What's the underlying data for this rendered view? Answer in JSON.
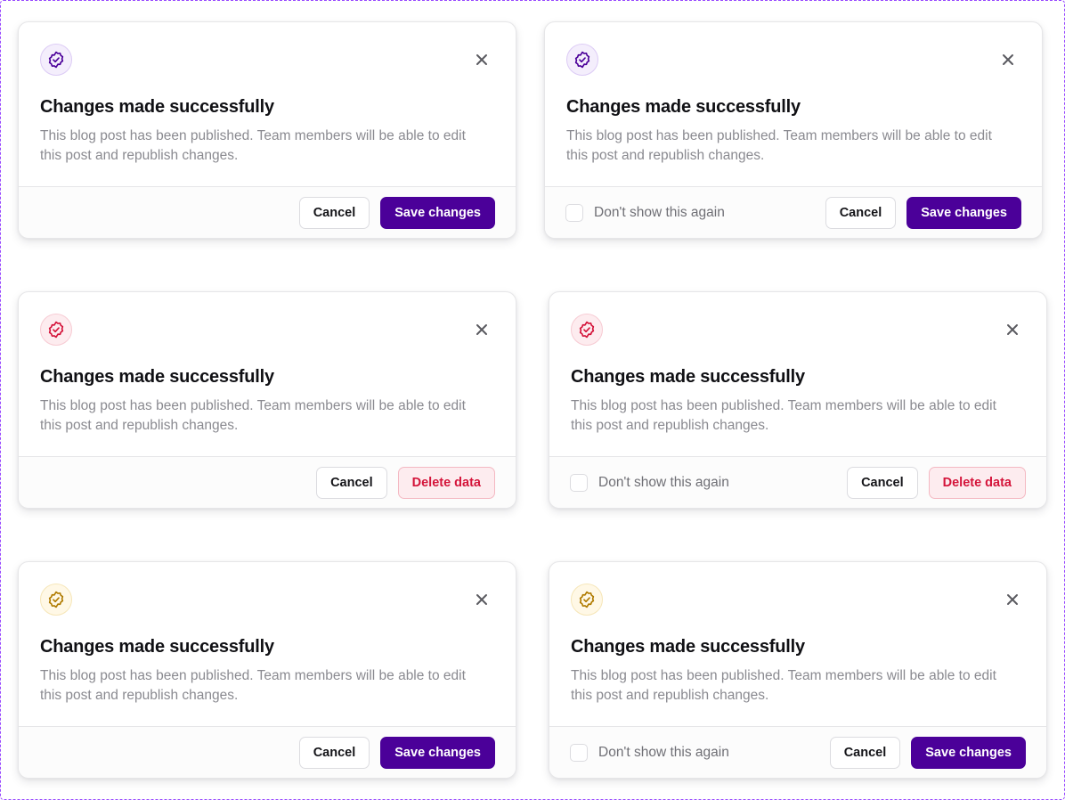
{
  "colors": {
    "primary": "#4b0099",
    "danger": "#d4143a",
    "warning": "#b07b00",
    "frame_border": "#9747ff"
  },
  "modals": [
    {
      "variant": "purple",
      "icon": "badge-check-icon",
      "title": "Changes made successfully",
      "description": "This blog post has been published. Team members will be able to edit this post and republish changes.",
      "checkbox_label": "",
      "cancel_label": "Cancel",
      "action_label": "Save changes"
    },
    {
      "variant": "purple",
      "icon": "badge-check-icon",
      "title": "Changes made successfully",
      "description": "This blog post has been published. Team members will be able to edit this post and republish changes.",
      "checkbox_label": "Don't show this again",
      "cancel_label": "Cancel",
      "action_label": "Save changes"
    },
    {
      "variant": "red",
      "icon": "badge-check-icon",
      "title": "Changes made successfully",
      "description": "This blog post has been published. Team members will be able to edit this post and republish changes.",
      "checkbox_label": "",
      "cancel_label": "Cancel",
      "action_label": "Delete data"
    },
    {
      "variant": "red",
      "icon": "badge-check-icon",
      "title": "Changes made successfully",
      "description": "This blog post has been published. Team members will be able to edit this post and republish changes.",
      "checkbox_label": "Don't show this again",
      "cancel_label": "Cancel",
      "action_label": "Delete data"
    },
    {
      "variant": "yellow",
      "icon": "badge-check-icon",
      "title": "Changes made successfully",
      "description": "This blog post has been published. Team members will be able to edit this post and republish changes.",
      "checkbox_label": "",
      "cancel_label": "Cancel",
      "action_label": "Save changes"
    },
    {
      "variant": "yellow",
      "icon": "badge-check-icon",
      "title": "Changes made successfully",
      "description": "This blog post has been published. Team members will be able to edit this post and republish changes.",
      "checkbox_label": "Don't show this again",
      "cancel_label": "Cancel",
      "action_label": "Save changes"
    }
  ]
}
